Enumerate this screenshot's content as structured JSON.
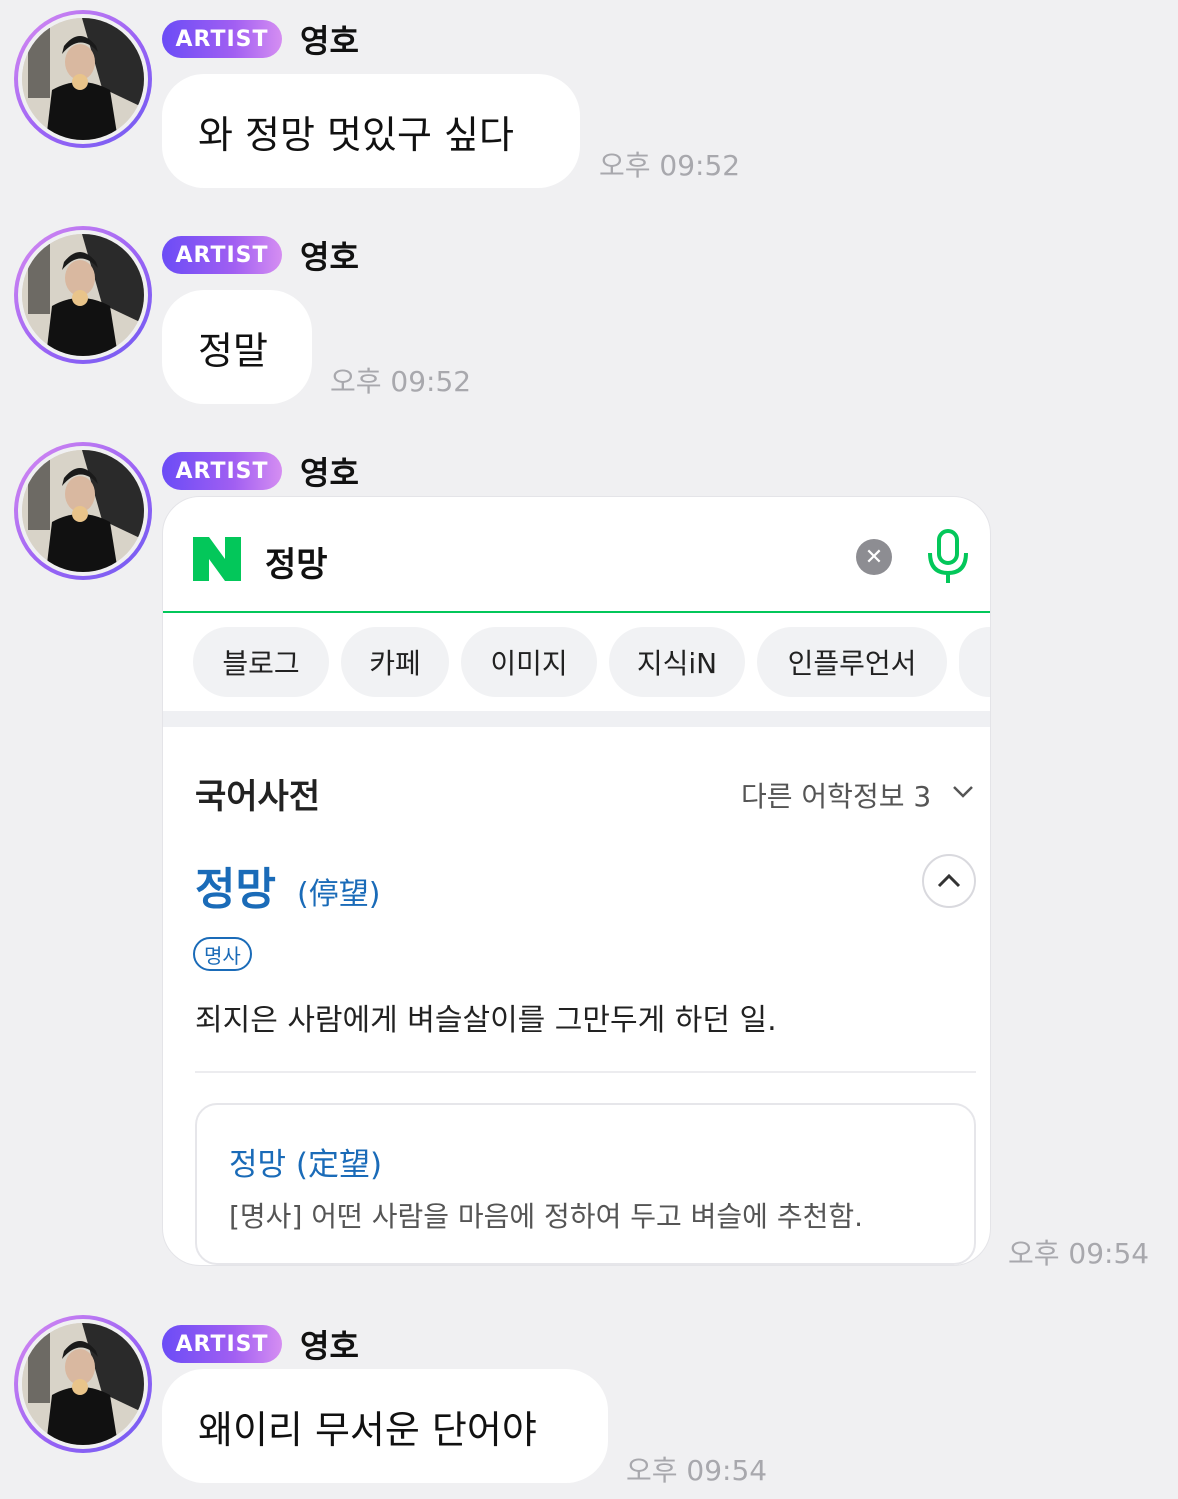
{
  "artist_badge": "ARTIST",
  "messages": [
    {
      "name": "영호",
      "text": "와 정망 멋있구 싶다",
      "time": "오후 09:52"
    },
    {
      "name": "영호",
      "text": "정말",
      "time": "오후 09:52"
    },
    {
      "name": "영호",
      "time": "오후 09:54"
    },
    {
      "name": "영호",
      "text": "왜이리 무서운 단어야",
      "time": "오후 09:54"
    }
  ],
  "search_card": {
    "query": "정망",
    "tabs": [
      "블로그",
      "카페",
      "이미지",
      "지식iN",
      "인플루언서"
    ],
    "dictionary_title": "국어사전",
    "other_info": "다른 어학정보 3",
    "entry": {
      "word": "정망",
      "hanja": "(停望)",
      "pos": "명사",
      "definition": "죄지은 사람에게 벼슬살이를 그만두게 하던 일."
    },
    "related": {
      "word": "정망 (定望)",
      "definition": "[명사] 어떤 사람을 마음에 정하여 두고 벼슬에 추천함."
    }
  },
  "colors": {
    "naver_green": "#03c75a",
    "link_blue": "#1a6bb8",
    "badge_purple": "#6b4cf6"
  },
  "icons": [
    "naver-logo-icon",
    "clear-icon",
    "microphone-icon",
    "chevron-down-icon",
    "chevron-up-icon"
  ]
}
